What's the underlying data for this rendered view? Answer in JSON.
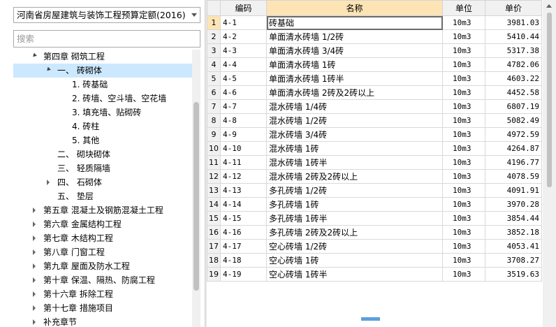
{
  "quota": {
    "selected": "河南省房屋建筑与装饰工程预算定额(2016)"
  },
  "search": {
    "placeholder": "搜索"
  },
  "tree": [
    {
      "label": "第四章 砌筑工程",
      "level": 1,
      "state": "expanded"
    },
    {
      "label": "一、 砖砌体",
      "level": 2,
      "state": "expanded",
      "selected": true
    },
    {
      "label": "1. 砖基础",
      "level": 3,
      "state": "leaf"
    },
    {
      "label": "2. 砖墙、空斗墙、空花墙",
      "level": 3,
      "state": "leaf"
    },
    {
      "label": "3. 填充墙、贴砌砖",
      "level": 3,
      "state": "leaf"
    },
    {
      "label": "4. 砖柱",
      "level": 3,
      "state": "leaf"
    },
    {
      "label": "5. 其他",
      "level": 3,
      "state": "leaf"
    },
    {
      "label": "二、 砌块砌体",
      "level": 2,
      "state": "leaf"
    },
    {
      "label": "三、 轻质隔墙",
      "level": 2,
      "state": "leaf"
    },
    {
      "label": "四、 石砌体",
      "level": 2,
      "state": "collapsed"
    },
    {
      "label": "五、 垫层",
      "level": 2,
      "state": "leaf"
    },
    {
      "label": "第五章 混凝土及钢筋混凝土工程",
      "level": 1,
      "state": "collapsed"
    },
    {
      "label": "第六章 金属结构工程",
      "level": 1,
      "state": "collapsed"
    },
    {
      "label": "第七章 木结构工程",
      "level": 1,
      "state": "collapsed"
    },
    {
      "label": "第八章 门窗工程",
      "level": 1,
      "state": "collapsed"
    },
    {
      "label": "第九章 屋面及防水工程",
      "level": 1,
      "state": "collapsed"
    },
    {
      "label": "第十章 保温、隔热、防腐工程",
      "level": 1,
      "state": "collapsed"
    },
    {
      "label": "第十六章 拆除工程",
      "level": 1,
      "state": "collapsed"
    },
    {
      "label": "第十七章 措施项目",
      "level": 1,
      "state": "collapsed"
    },
    {
      "label": "补充章节",
      "level": 1,
      "state": "collapsed"
    }
  ],
  "table": {
    "headers": [
      "编码",
      "名称",
      "单位",
      "单价"
    ],
    "rows": [
      {
        "n": "1",
        "code": "4-1",
        "name": "砖基础",
        "unit": "10m3",
        "price": "3981.03"
      },
      {
        "n": "2",
        "code": "4-2",
        "name": "单面清水砖墙 1/2砖",
        "unit": "10m3",
        "price": "5410.44"
      },
      {
        "n": "3",
        "code": "4-3",
        "name": "单面清水砖墙 3/4砖",
        "unit": "10m3",
        "price": "5317.38"
      },
      {
        "n": "4",
        "code": "4-4",
        "name": "单面清水砖墙 1砖",
        "unit": "10m3",
        "price": "4782.06"
      },
      {
        "n": "5",
        "code": "4-5",
        "name": "单面清水砖墙 1砖半",
        "unit": "10m3",
        "price": "4603.22"
      },
      {
        "n": "6",
        "code": "4-6",
        "name": "单面清水砖墙 2砖及2砖以上",
        "unit": "10m3",
        "price": "4452.58"
      },
      {
        "n": "7",
        "code": "4-7",
        "name": "混水砖墙 1/4砖",
        "unit": "10m3",
        "price": "6807.19"
      },
      {
        "n": "8",
        "code": "4-8",
        "name": "混水砖墙 1/2砖",
        "unit": "10m3",
        "price": "5082.49"
      },
      {
        "n": "9",
        "code": "4-9",
        "name": "混水砖墙 3/4砖",
        "unit": "10m3",
        "price": "4972.59"
      },
      {
        "n": "10",
        "code": "4-10",
        "name": "混水砖墙 1砖",
        "unit": "10m3",
        "price": "4264.87"
      },
      {
        "n": "11",
        "code": "4-11",
        "name": "混水砖墙 1砖半",
        "unit": "10m3",
        "price": "4196.77"
      },
      {
        "n": "12",
        "code": "4-12",
        "name": "混水砖墙 2砖及2砖以上",
        "unit": "10m3",
        "price": "4078.59"
      },
      {
        "n": "13",
        "code": "4-13",
        "name": "多孔砖墙 1/2砖",
        "unit": "10m3",
        "price": "4091.91"
      },
      {
        "n": "14",
        "code": "4-14",
        "name": "多孔砖墙 1砖",
        "unit": "10m3",
        "price": "3970.28"
      },
      {
        "n": "15",
        "code": "4-15",
        "name": "多孔砖墙 1砖半",
        "unit": "10m3",
        "price": "3854.44"
      },
      {
        "n": "16",
        "code": "4-16",
        "name": "多孔砖墙 2砖及2砖以上",
        "unit": "10m3",
        "price": "3852.18"
      },
      {
        "n": "17",
        "code": "4-17",
        "name": "空心砖墙 1/2砖",
        "unit": "10m3",
        "price": "4053.41"
      },
      {
        "n": "18",
        "code": "4-18",
        "name": "空心砖墙 1砖",
        "unit": "10m3",
        "price": "3708.27"
      },
      {
        "n": "19",
        "code": "4-19",
        "name": "空心砖墙 1砖半",
        "unit": "10m3",
        "price": "3519.63"
      }
    ]
  }
}
